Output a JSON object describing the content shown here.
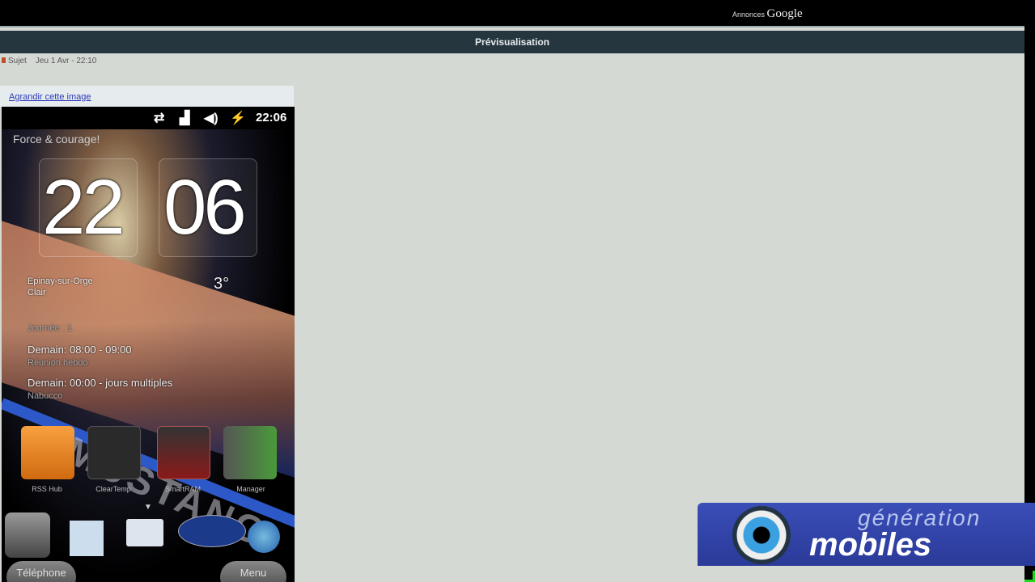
{
  "topbar": {
    "ads_prefix": "Annonces",
    "ads_brand": "Google"
  },
  "window": {
    "title": "Prévisualisation"
  },
  "post": {
    "subject": "Sujet",
    "date": "Jeu 1 Avr - 22:10",
    "enlarge_link": "Agrandir cette image"
  },
  "phone": {
    "status_time": "22:06",
    "clock_label": "Force & courage!",
    "clock_hours": "22",
    "clock_minutes": "06",
    "weather_city": "Epinay-sur-Orge",
    "weather_desc": "Clair",
    "weather_temp": "3°",
    "agenda_day": "Journée : 1",
    "event1_time": "Demain: 08:00 - 09:00",
    "event1_title": "Réunion hebdo",
    "event2_time": "Demain: 00:00 - jours multiples",
    "event2_title": "Nabucco",
    "wallpaper_text": "MUSTANG",
    "apps": [
      {
        "label": "RSS Hub",
        "color": "#f08a1c"
      },
      {
        "label": "ClearTemp",
        "color": "#333"
      },
      {
        "label": "SmartRAM",
        "color": "#8a1a1a"
      },
      {
        "label": "Manager",
        "color": "#4a8a3a"
      }
    ],
    "softkeys": {
      "left": "Téléphone",
      "right": "Menu"
    }
  },
  "logo": {
    "top": "génération",
    "bottom": "mobiles"
  }
}
